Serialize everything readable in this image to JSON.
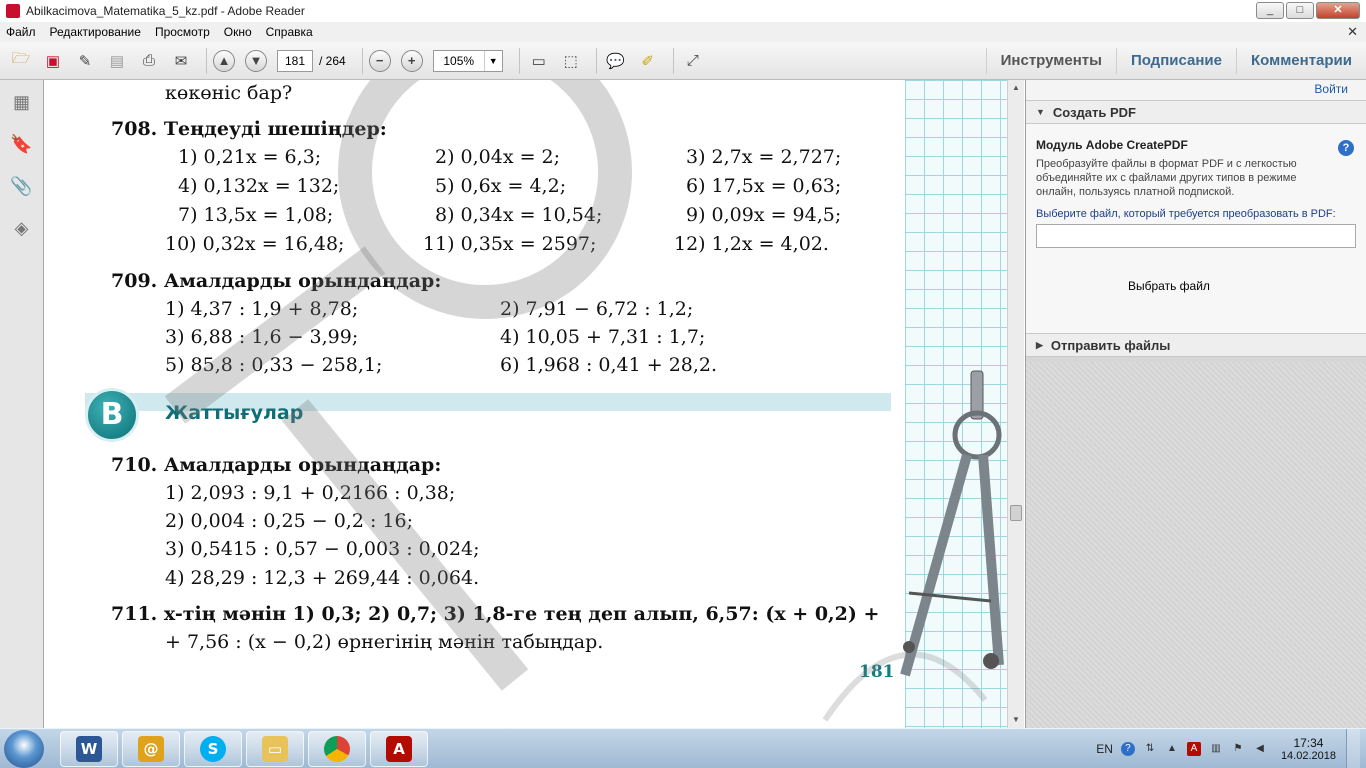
{
  "window": {
    "title": "Abilkacimova_Matematika_5_kz.pdf - Adobe Reader",
    "min": "_",
    "max": "□",
    "close": "✕"
  },
  "menu": [
    "Файл",
    "Редактирование",
    "Просмотр",
    "Окно",
    "Справка"
  ],
  "toolbar": {
    "page_current": "181",
    "page_total": "/ 264",
    "zoom": "105%",
    "tabs": [
      "Инструменты",
      "Подписание",
      "Комментарии"
    ]
  },
  "right_pane": {
    "login": "Войти",
    "create_pdf": "Создать PDF",
    "module_title": "Модуль Adobe CreatePDF",
    "description": "Преобразуйте файлы в формат PDF и с легкостью объединяйте их с файлами других типов в режиме онлайн, пользуясь платной подпиской.",
    "select_prompt": "Выберите файл, который требуется преобразовать в PDF:",
    "choose_button": "Выбрать файл",
    "send_files": "Отправить файлы"
  },
  "document": {
    "lines": [
      "көкөніс бар?",
      "708. Теңдеуді шешіңдер:",
      "1) 0,21x = 6,3;",
      "2) 0,04x = 2;",
      "3) 2,7x = 2,727;",
      "4) 0,132x = 132;",
      "5) 0,6x = 4,2;",
      "6) 17,5x = 0,63;",
      "7) 13,5x = 1,08;",
      "8) 0,34x = 10,54;",
      "9) 0,09x = 94,5;",
      "10) 0,32x = 16,48;",
      "11) 0,35x = 2597;",
      "12) 1,2x = 4,02.",
      "709. Амалдарды орындаңдар:",
      "1) 4,37 : 1,9 + 8,78;",
      "2) 7,91 − 6,72 : 1,2;",
      "3) 6,88 : 1,6 − 3,99;",
      "4) 10,05 + 7,31 : 1,7;",
      "5) 85,8 : 0,33 − 258,1;",
      "6) 1,968 : 0,41 + 28,2.",
      "710. Амалдарды орындаңдар:",
      "1) 2,093 : 9,1 + 0,2166 : 0,38;",
      "2) 0,004 : 0,25 − 0,2 : 16;",
      "3) 0,5415 : 0,57 − 0,003 : 0,024;",
      "4) 28,29 : 12,3 + 269,44 : 0,064.",
      "711. x-тің мәнін 1) 0,3; 2) 0,7; 3) 1,8-ге тең деп алып, 6,57: (x + 0,2) +",
      "+ 7,56 : (x − 0,2) өрнегінің мәнін табыңдар."
    ],
    "section_badge": "B",
    "section_title": "Жаттығулар",
    "page_number": "181"
  },
  "taskbar": {
    "lang": "EN",
    "time": "17:34",
    "date": "14.02.2018"
  }
}
